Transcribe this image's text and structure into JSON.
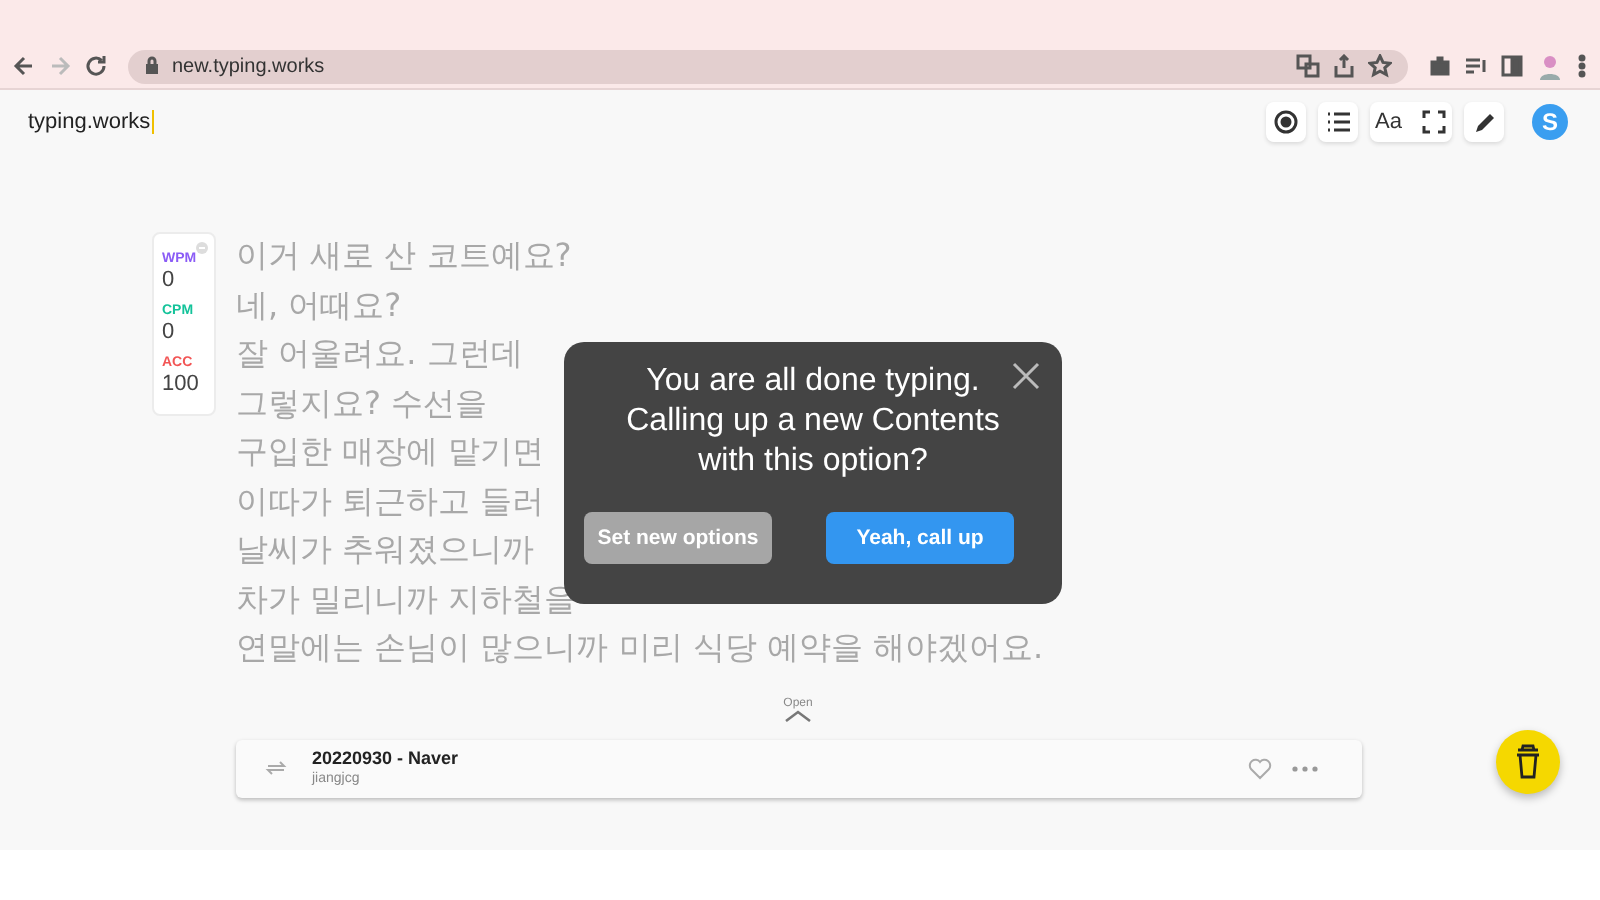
{
  "browser": {
    "url": "new.typing.works"
  },
  "header": {
    "logo": "typing.works",
    "font_button": "Aa",
    "avatar": "S"
  },
  "stats": [
    {
      "label": "WPM",
      "value": "0",
      "color": "#8b5cf6"
    },
    {
      "label": "CPM",
      "value": "0",
      "color": "#14c39a"
    },
    {
      "label": "ACC",
      "value": "100",
      "color": "#f25555"
    }
  ],
  "lines": [
    "이거 새로 산 코트예요?",
    "네, 어때요?",
    "잘 어울려요. 그런데",
    "그렇지요? 수선을",
    "구입한 매장에 맡기면",
    "이따가 퇴근하고 들러",
    "날씨가 추워졌으니까",
    "차가 밀리니까 지하철을",
    "연말에는 손님이 많으니까 미리 식당 예약을 해야겠어요."
  ],
  "dialog": {
    "message": "You are all done typing. Calling up a new Contents with this option?",
    "buttons": [
      {
        "label": "Set new options",
        "kind": "secondary"
      },
      {
        "label": "Yeah, call up",
        "kind": "primary"
      }
    ]
  },
  "open_label": "Open",
  "content": {
    "title": "20220930 - Naver",
    "author": "jiangjcg",
    "liked": false
  }
}
